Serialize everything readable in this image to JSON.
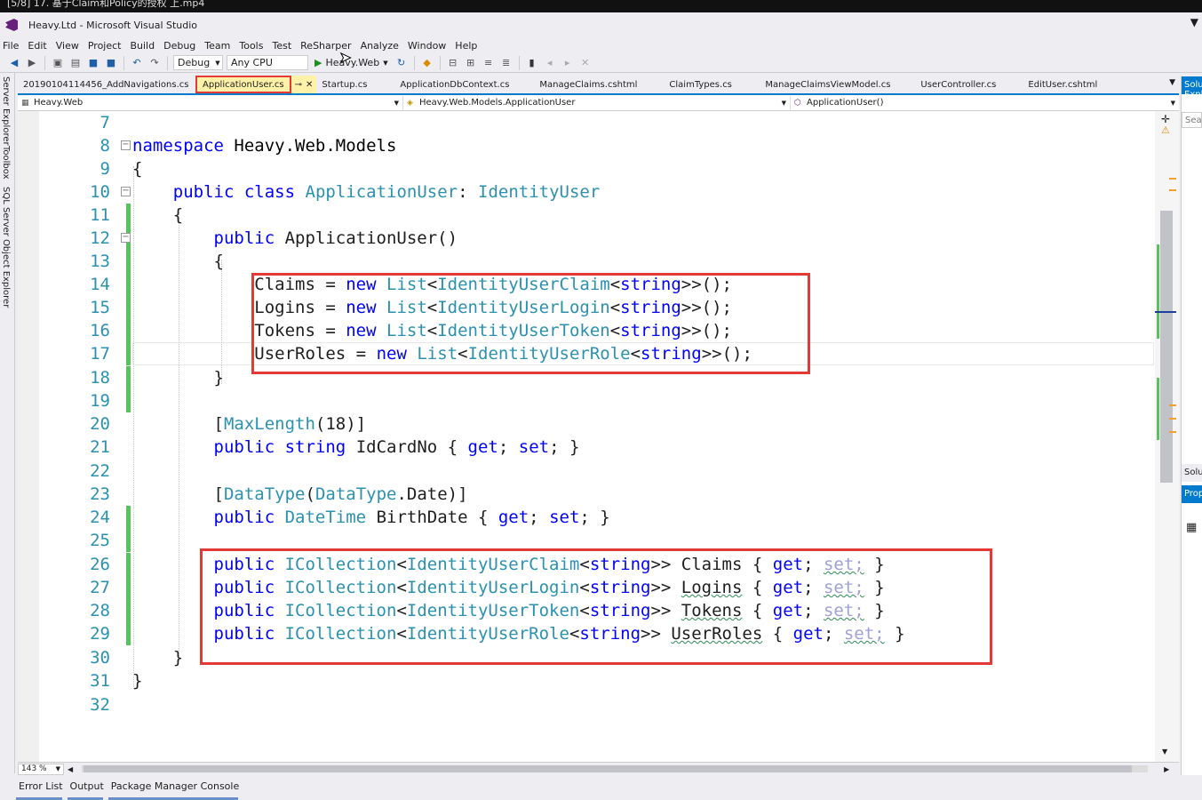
{
  "player": {
    "title": "[5/8] 17. 基于Claim和Policy的授权 上.mp4"
  },
  "window": {
    "title": "Heavy.Ltd - Microsoft Visual Studio"
  },
  "menu": [
    "File",
    "Edit",
    "View",
    "Project",
    "Build",
    "Debug",
    "Team",
    "Tools",
    "Test",
    "ReSharper",
    "Analyze",
    "Window",
    "Help"
  ],
  "toolbar": {
    "config": "Debug",
    "platform": "Any CPU",
    "run_label": "Heavy.Web"
  },
  "tabs": [
    "20190104114456_AddNavigations.cs",
    "ApplicationUser.cs",
    "Startup.cs",
    "ApplicationDbContext.cs",
    "ManageClaims.cshtml",
    "ClaimTypes.cs",
    "ManageClaimsViewModel.cs",
    "UserController.cs",
    "EditUser.cshtml"
  ],
  "active_tab": "ApplicationUser.cs",
  "navbar": {
    "project": "Heavy.Web",
    "type": "Heavy.Web.Models.ApplicationUser",
    "member": "ApplicationUser()"
  },
  "left_rail": [
    "Server Explorer",
    "Toolbox",
    "SQL Server Object Explorer"
  ],
  "code_lines": [
    "7",
    "8",
    "9",
    "10",
    "11",
    "12",
    "13",
    "14",
    "15",
    "16",
    "17",
    "18",
    "19",
    "20",
    "21",
    "22",
    "23",
    "24",
    "25",
    "26",
    "27",
    "28",
    "29",
    "30",
    "31",
    "32"
  ],
  "code": {
    "l8a": "namespace",
    "l8b": " Heavy.Web.Models",
    "l9": "{",
    "l10a": "public",
    "l10b": "class",
    "l10c": "ApplicationUser",
    "l10d": ": ",
    "l10e": "IdentityUser",
    "l11": "{",
    "l12a": "public",
    "l12b": " ApplicationUser()",
    "l13": "{",
    "l14a": "Claims = ",
    "l14b": "new",
    "l14c": "List",
    "l14d": "<",
    "l14e": "IdentityUserClaim",
    "l14f": "<",
    "l14g": "string",
    "l14h": ">>();",
    "l15a": "Logins = ",
    "l15b": "new",
    "l15c": "List",
    "l15d": "<",
    "l15e": "IdentityUserLogin",
    "l15f": "<",
    "l15g": "string",
    "l15h": ">>();",
    "l16a": "Tokens = ",
    "l16b": "new",
    "l16c": "List",
    "l16d": "<",
    "l16e": "IdentityUserToken",
    "l16f": "<",
    "l16g": "string",
    "l16h": ">>();",
    "l17a": "UserRoles = ",
    "l17b": "new",
    "l17c": "List",
    "l17d": "<",
    "l17e": "IdentityUserRole",
    "l17f": "<",
    "l17g": "string",
    "l17h": ">>();",
    "l18": "}",
    "l20a": "[",
    "l20b": "MaxLength",
    "l20c": "(18)]",
    "l21a": "public",
    "l21b": "string",
    "l21c": " IdCardNo { ",
    "l21d": "get",
    "l21e": "; ",
    "l21f": "set",
    "l21g": "; }",
    "l23a": "[",
    "l23b": "DataType",
    "l23c": "(",
    "l23d": "DataType",
    "l23e": ".Date)]",
    "l24a": "public",
    "l24b": "DateTime",
    "l24c": " BirthDate { ",
    "l24d": "get",
    "l24e": "; ",
    "l24f": "set",
    "l24g": "; }",
    "l26": [
      "public",
      "ICollection",
      "<",
      "IdentityUserClaim",
      "<",
      "string",
      ">> ",
      "Claims",
      " { ",
      "get",
      "; ",
      "set;",
      " }"
    ],
    "l27": [
      "public",
      "ICollection",
      "<",
      "IdentityUserLogin",
      "<",
      "string",
      ">> ",
      "Logins",
      " { ",
      "get",
      "; ",
      "set;",
      " }"
    ],
    "l28": [
      "public",
      "ICollection",
      "<",
      "IdentityUserToken",
      "<",
      "string",
      ">> ",
      "Tokens",
      " { ",
      "get",
      "; ",
      "set;",
      " }"
    ],
    "l29": [
      "public",
      "ICollection",
      "<",
      "IdentityUserRole",
      "<",
      "string",
      ">> ",
      "UserRoles",
      " { ",
      "get",
      "; ",
      "set;",
      " }"
    ],
    "l30": "}",
    "l31": "}"
  },
  "zoom": "143 %",
  "bottom_tabs": [
    "Error List",
    "Output",
    "Package Manager Console"
  ],
  "right_panel": {
    "solution": "Solution Explorer",
    "search": "Search",
    "solution2": "Solution",
    "properties": "Properties"
  },
  "colors": {
    "keyword": "#0000ff",
    "type": "#2b91af",
    "accent": "#007acc",
    "highlight": "#e53935"
  }
}
